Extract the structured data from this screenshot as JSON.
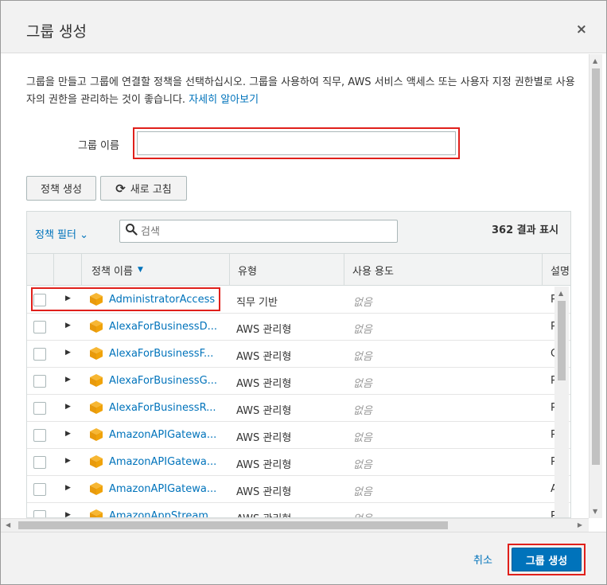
{
  "dialog": {
    "title": "그룹 생성",
    "close_icon": "×"
  },
  "description": {
    "text": "그룹을 만들고 그룹에 연결할 정책을 선택하십시오. 그룹을 사용하여 직무, AWS 서비스 액세스 또는 사용자 지정 권한별로 사용자의 권한을 관리하는 것이 좋습니다.",
    "link": "자세히 알아보기"
  },
  "group_name": {
    "label": "그룹 이름",
    "value": ""
  },
  "buttons": {
    "create_policy": "정책 생성",
    "refresh": "새로 고침",
    "refresh_icon": "⟳"
  },
  "filter": {
    "label": "정책 필터",
    "chevron": "⌄",
    "search_placeholder": "검색",
    "count": "362 결과 표시"
  },
  "columns": {
    "name": "정책 이름",
    "type": "유형",
    "usage": "사용 용도",
    "description": "설명"
  },
  "rows": [
    {
      "name": "AdministratorAccess",
      "type": "직무 기반",
      "usage": "없음",
      "desc": "P"
    },
    {
      "name": "AlexaForBusinessD...",
      "type": "AWS 관리형",
      "usage": "없음",
      "desc": "P"
    },
    {
      "name": "AlexaForBusinessF...",
      "type": "AWS 관리형",
      "usage": "없음",
      "desc": "G"
    },
    {
      "name": "AlexaForBusinessG...",
      "type": "AWS 관리형",
      "usage": "없음",
      "desc": "P"
    },
    {
      "name": "AlexaForBusinessR...",
      "type": "AWS 관리형",
      "usage": "없음",
      "desc": "P"
    },
    {
      "name": "AmazonAPIGatewa...",
      "type": "AWS 관리형",
      "usage": "없음",
      "desc": "P"
    },
    {
      "name": "AmazonAPIGatewa...",
      "type": "AWS 관리형",
      "usage": "없음",
      "desc": "P"
    },
    {
      "name": "AmazonAPIGatewa...",
      "type": "AWS 관리형",
      "usage": "없음",
      "desc": "A"
    },
    {
      "name": "AmazonAppStream",
      "type": "AWS 관리형",
      "usage": "없음",
      "desc": "P"
    }
  ],
  "footer": {
    "cancel": "취소",
    "create_group": "그룹 생성"
  },
  "colors": {
    "accent": "#0073bb",
    "highlight": "#e0201b",
    "policy_icon": "#f0a30a"
  }
}
